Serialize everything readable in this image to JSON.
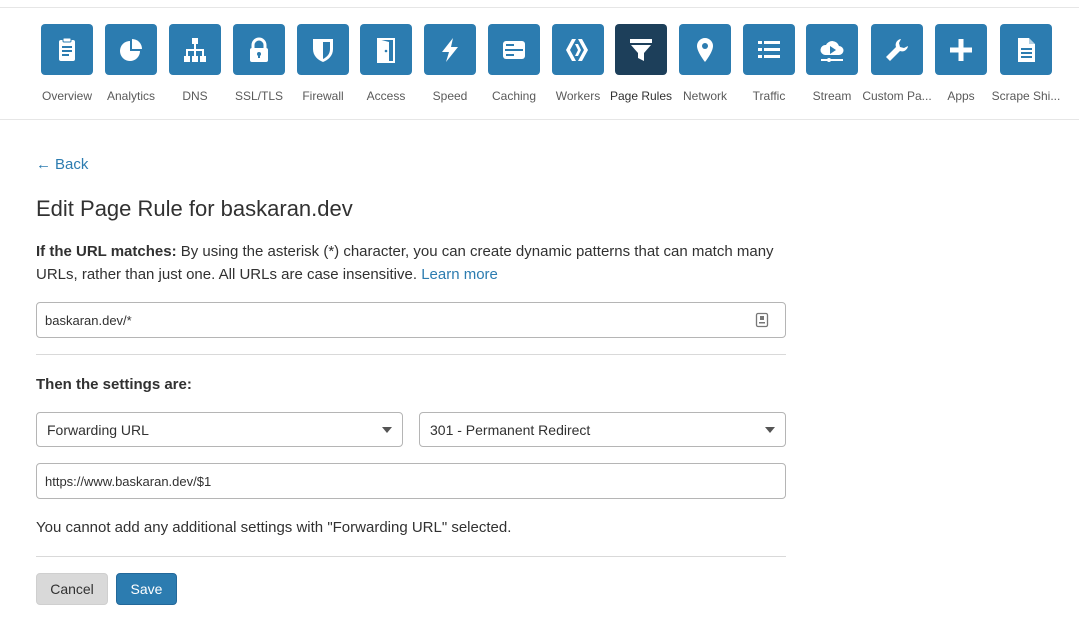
{
  "colors": {
    "accent": "#2c7cb0",
    "active_tile": "#1d3f5a",
    "text": "#313131"
  },
  "nav": {
    "items": [
      {
        "label": "Overview",
        "icon": "clipboard-icon"
      },
      {
        "label": "Analytics",
        "icon": "pie-chart-icon"
      },
      {
        "label": "DNS",
        "icon": "network-tree-icon"
      },
      {
        "label": "SSL/TLS",
        "icon": "lock-icon"
      },
      {
        "label": "Firewall",
        "icon": "shield-icon"
      },
      {
        "label": "Access",
        "icon": "door-icon"
      },
      {
        "label": "Speed",
        "icon": "lightning-icon"
      },
      {
        "label": "Caching",
        "icon": "server-icon"
      },
      {
        "label": "Workers",
        "icon": "workers-icon"
      },
      {
        "label": "Page Rules",
        "icon": "filter-icon"
      },
      {
        "label": "Network",
        "icon": "location-pin-icon"
      },
      {
        "label": "Traffic",
        "icon": "list-icon"
      },
      {
        "label": "Stream",
        "icon": "cloud-play-icon"
      },
      {
        "label": "Custom Pa...",
        "icon": "wrench-icon"
      },
      {
        "label": "Apps",
        "icon": "plus-icon"
      },
      {
        "label": "Scrape Shi...",
        "icon": "document-icon"
      }
    ],
    "active": "Page Rules"
  },
  "back_label": "Back",
  "title": "Edit Page Rule for baskaran.dev",
  "match": {
    "label": "If the URL matches:",
    "description": " By using the asterisk (*) character, you can create dynamic patterns that can match many URLs, rather than just one. All URLs are case insensitive. ",
    "learn_more": "Learn more",
    "url_value": "baskaran.dev/*"
  },
  "settings": {
    "label": "Then the settings are:",
    "setting_select": "Forwarding URL",
    "status_select": "301 - Permanent Redirect",
    "destination_value": "https://www.baskaran.dev/$1",
    "note": "You cannot add any additional settings with \"Forwarding URL\" selected."
  },
  "buttons": {
    "cancel": "Cancel",
    "save": "Save"
  }
}
